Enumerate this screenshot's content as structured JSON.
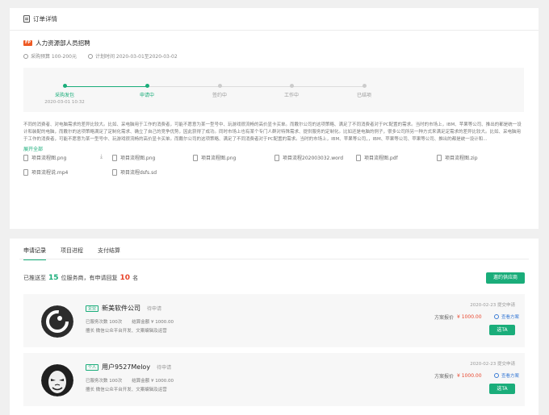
{
  "header": {
    "title": "订单详情"
  },
  "project": {
    "tag": "FP",
    "name": "人力资源部人员招聘",
    "budget": "采购预算 100-200元",
    "plan_time": "计划时间 2020-03-01至2020-03-02"
  },
  "steps": [
    {
      "label": "采购发包",
      "time": "2020-03-01 10:32",
      "active": true
    },
    {
      "label": "申请中",
      "time": "",
      "active": true
    },
    {
      "label": "签约中",
      "time": "",
      "active": false
    },
    {
      "label": "工作中",
      "time": "",
      "active": false
    },
    {
      "label": "已结项",
      "time": "",
      "active": false
    }
  ],
  "description": "不同的消费者、对电脑需求的差异比较大。比如、采电脑用于工作的消费者，可能不愿意为某一型号中、玩游戏很流畅的高价显卡买单。而戴尔公司的这项策略、满足了不同消费者对于PC配置的需求。当时的市场上，IBM、苹果等公司、推出的都是统一设计和装配的电脑，而戴尔的这项策略满足了定制化需求、确立了自己的竞争优势，因此获得了成功。同时市场上也有某个专门人群对特殊需求、提供服务的定制化。比如还是电脑的例子，很多公司所另一种方式来满足定需求的差异比较大。比如、采电脑用于工作的消费者，可能不愿意为某一型号中、玩游戏很流畅的高价显卡买单。而戴尔公司的这项策略、满足了不同消费者对于PC配置的需求。当时的市场上，IBM、苹果等公司，，IBM、苹果等公司、苹果等公司、推出的都是统一设计和...",
  "expand_label": "展开全部",
  "files": [
    {
      "name": "项目流程图.png"
    },
    {
      "name": "项目流程图.png"
    },
    {
      "name": "项目流程图.png"
    },
    {
      "name": "项目流程202003032.word"
    },
    {
      "name": "项目流程图.pdf"
    },
    {
      "name": "项目流程图.zip"
    },
    {
      "name": "项目流程说.mp4"
    },
    {
      "name": "项目流程dsfs.sd"
    }
  ],
  "tabs": [
    "申请记录",
    "项目进程",
    "支付结算"
  ],
  "summary": {
    "prefix": "已推送至",
    "sent": "15",
    "middle": "位服务商，有申请回复",
    "replied": "10",
    "suffix": "名"
  },
  "invite_label": "邀约供应商",
  "applicants": [
    {
      "badge": "企业",
      "name": "新美软件公司",
      "status": "待申请",
      "count": "已服务次数  100次",
      "amount": "结算金额  ¥ 1000.00",
      "skill": "擅长  微信公众平台开发、文案编辑及运营",
      "date": "2020-02-23  提交申请",
      "price_label": "方案报价",
      "price": "¥ 1000.00",
      "view": "查看方案",
      "action": "选TA"
    },
    {
      "badge": "个人",
      "name": "用户9527Meloy",
      "status": "待申请",
      "count": "已服务次数  100次",
      "amount": "结算金额  ¥ 1000.00",
      "skill": "擅长  微信公众平台开发、文案编辑及运营",
      "date": "2020-02-23  提交申请",
      "price_label": "方案报价",
      "price": "¥ 1000.00",
      "view": "查看方案",
      "action": "选TA"
    }
  ]
}
